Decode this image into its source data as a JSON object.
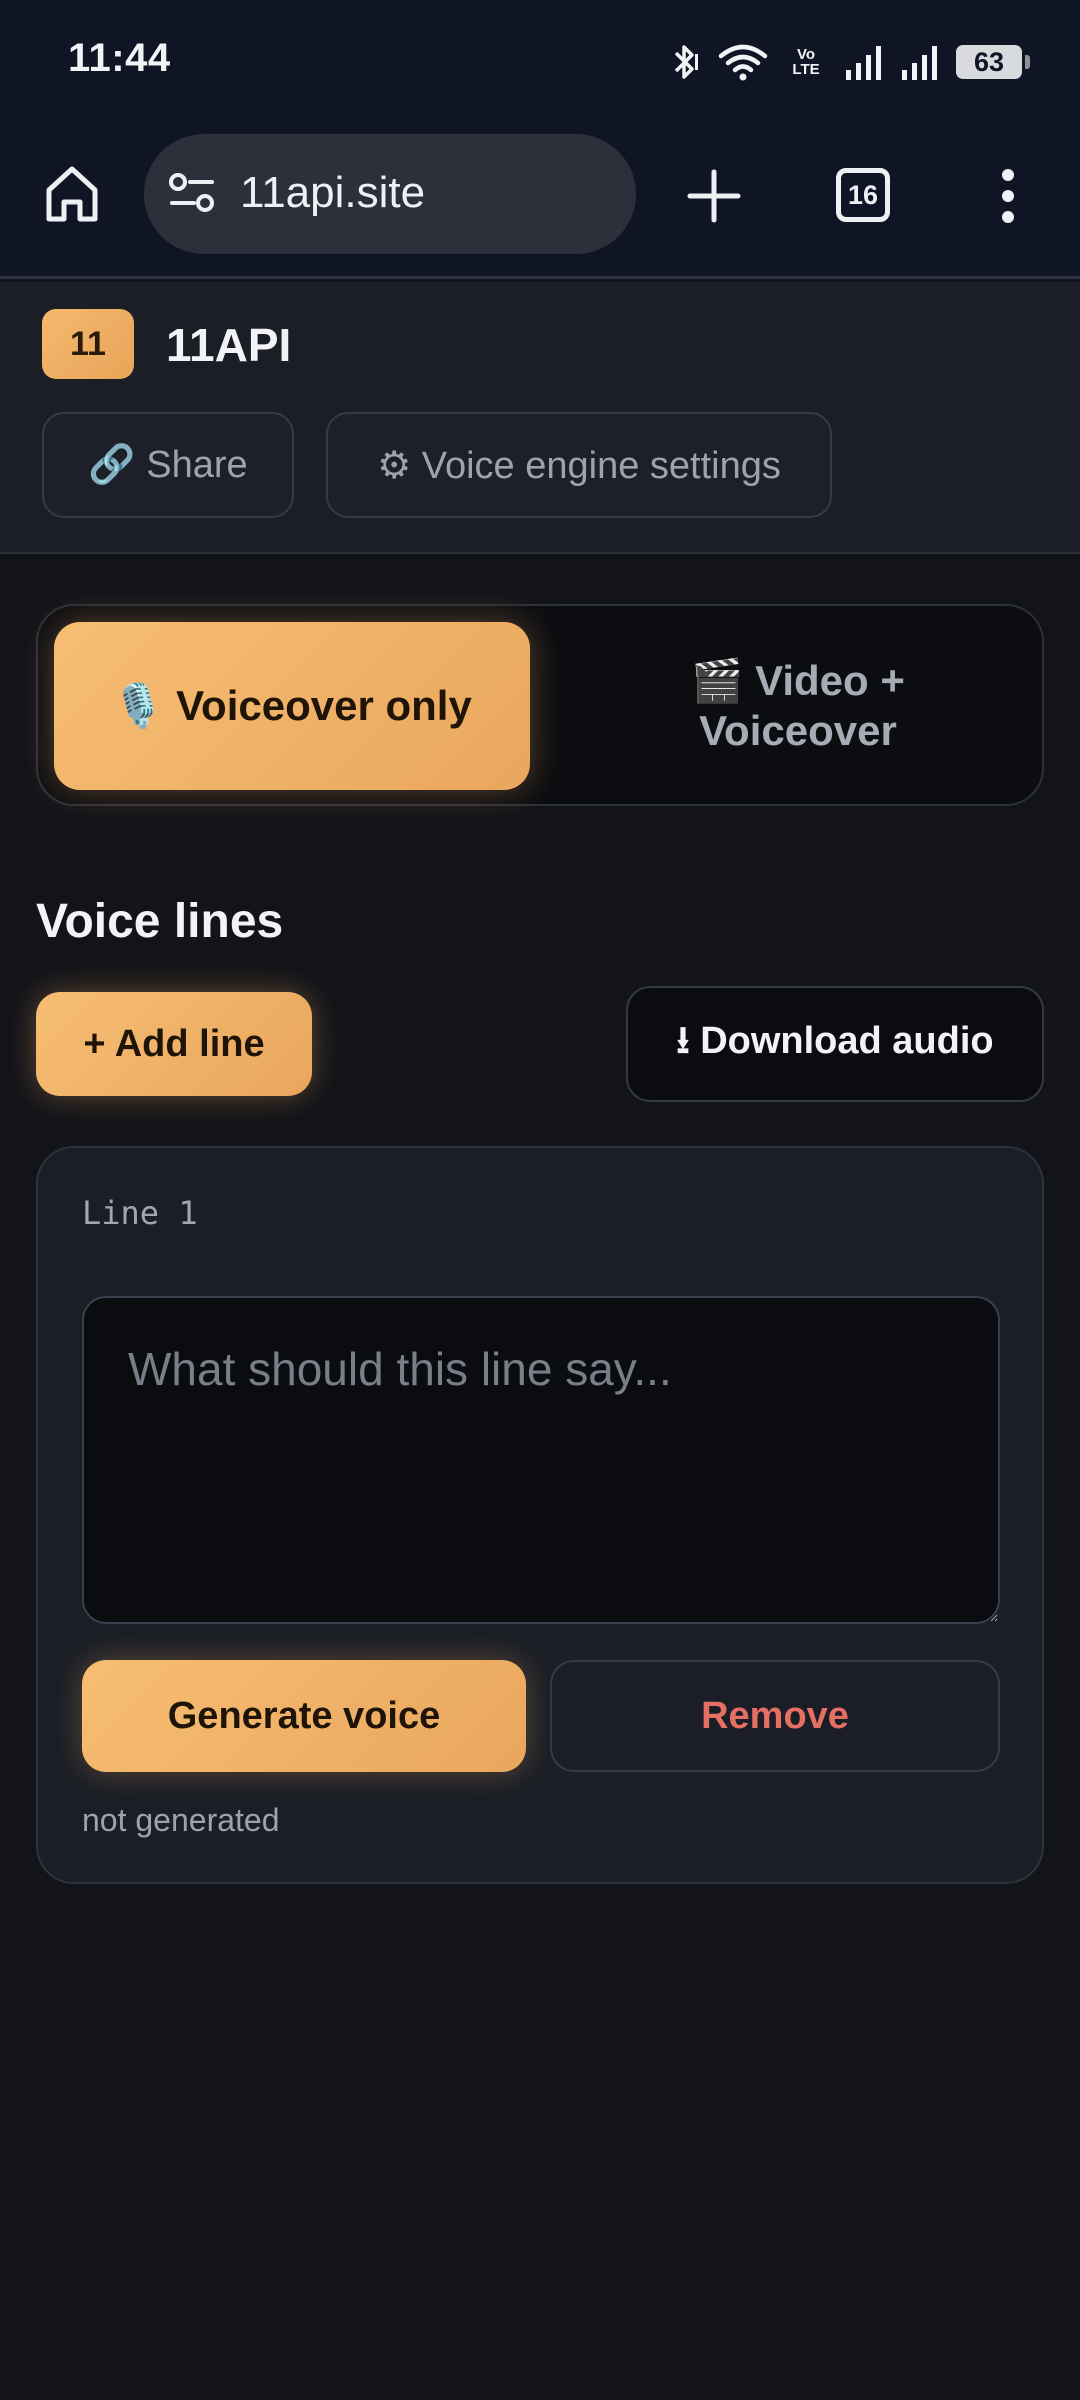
{
  "status_bar": {
    "time": "11:44",
    "battery": "63",
    "network_label": "Vo LTE",
    "icons": [
      "bluetooth-icon",
      "wifi-icon",
      "volte-icon",
      "signal-icon",
      "signal-icon",
      "battery-icon"
    ]
  },
  "browser": {
    "url": "11api.site",
    "tab_count": "16",
    "icons": [
      "home-icon",
      "site-settings-icon",
      "new-tab-plus-icon",
      "tab-switcher-icon",
      "overflow-menu-icon"
    ]
  },
  "app": {
    "badge": "11",
    "name": "11API",
    "share_label": "🔗 Share",
    "settings_label": "⚙ Voice engine settings"
  },
  "mode_toggle": {
    "active_label": "🎙️ Voiceover only",
    "inactive_line1": "🎬 Video +",
    "inactive_line2": "Voiceover",
    "selected": "Voiceover only"
  },
  "voice_lines": {
    "title": "Voice lines",
    "add_label": "+ Add line",
    "download_label": "⭳ Download audio",
    "lines": [
      {
        "label": "Line 1",
        "placeholder": "What should this line say...",
        "value": "",
        "generate_label": "Generate voice",
        "remove_label": "Remove",
        "status": "not generated"
      }
    ]
  },
  "colors": {
    "accent": "#f2b46a",
    "accent_text": "#1f1408",
    "danger": "#e66f63",
    "background": "#131419",
    "surface": "#1b1e26",
    "browser_bar": "#0f1524"
  }
}
